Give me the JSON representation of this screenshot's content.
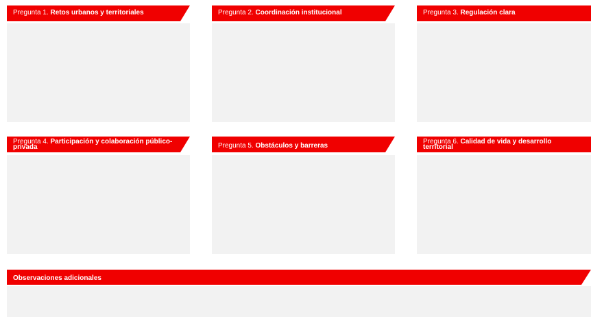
{
  "questions": [
    {
      "prefix": "Pregunta 1.",
      "title": "Retos urbanos y territoriales"
    },
    {
      "prefix": "Pregunta 2.",
      "title": "Coordinación institucional"
    },
    {
      "prefix": "Pregunta 3.",
      "title": "Regulación clara"
    },
    {
      "prefix": "Pregunta 4.",
      "title": "Participación y colaboración público-privada"
    },
    {
      "prefix": "Pregunta 5.",
      "title": "Obstáculos y barreras"
    },
    {
      "prefix": "Pregunta 6.",
      "title": "Calidad de vida y desarrollo territorial"
    }
  ],
  "observaciones": {
    "title": "Observaciones adicionales"
  },
  "colors": {
    "accent": "#f00000",
    "box_fill": "#f2f2f2",
    "tab_text": "#ffffff"
  }
}
